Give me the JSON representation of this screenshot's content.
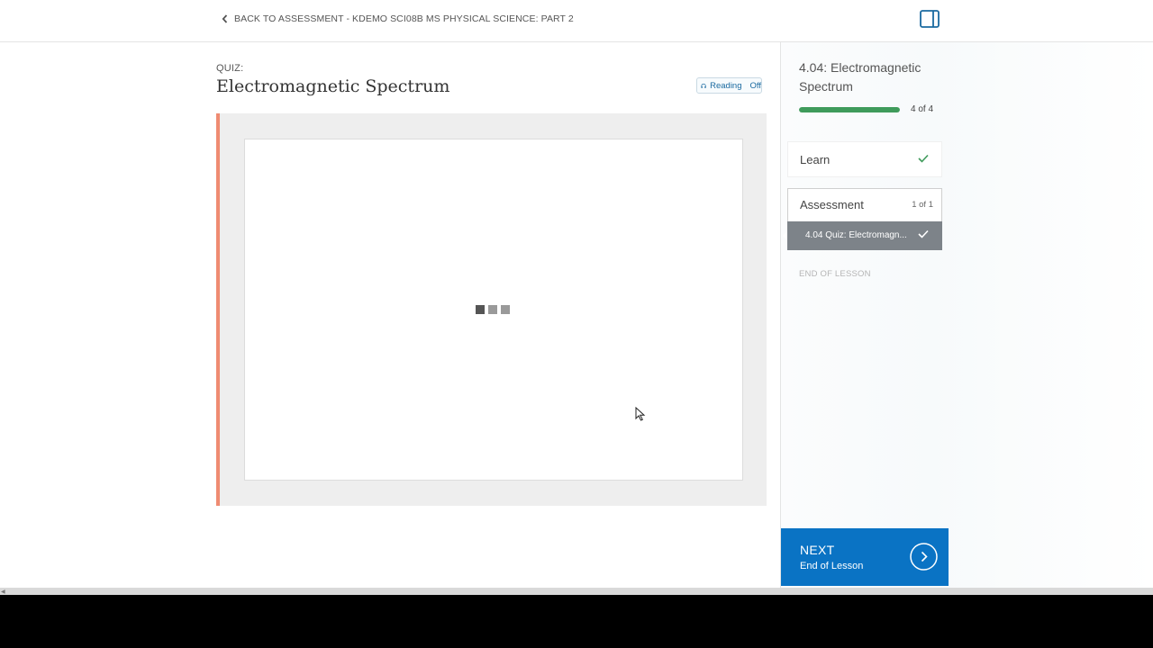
{
  "header": {
    "back_link": "BACK TO ASSESSMENT - KDEMO SCI08B MS PHYSICAL SCIENCE: PART 2"
  },
  "quiz": {
    "kicker": "QUIZ:",
    "title": "Electromagnetic Spectrum",
    "reading_label": "Reading",
    "reading_state": "Off"
  },
  "sidebar": {
    "lesson_title": "4.04: Electromagnetic Spectrum",
    "progress_label": "4 of 4",
    "progress_fraction": 1.0,
    "learn_label": "Learn",
    "assessment_label": "Assessment",
    "assessment_count": "1 of 1",
    "quiz_item_label": "4.04 Quiz: Electromagn...",
    "end_label": "END OF LESSON",
    "next_title": "NEXT",
    "next_sub": "End of Lesson"
  },
  "colors": {
    "accent_blue": "#0a73c4",
    "progress_green": "#3f9b5b",
    "quiz_accent": "#ef8b72",
    "active_item_bg": "#7d8389"
  }
}
